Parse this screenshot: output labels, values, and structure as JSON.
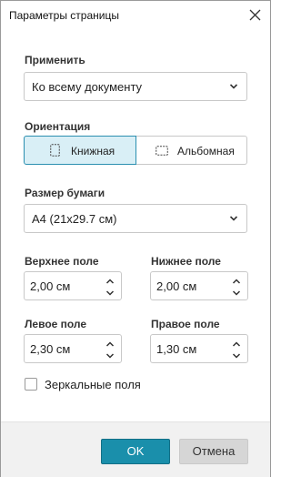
{
  "window": {
    "title": "Параметры страницы"
  },
  "apply": {
    "label": "Применить",
    "value": "Ко всему документу"
  },
  "orientation": {
    "label": "Ориентация",
    "portrait_label": "Книжная",
    "landscape_label": "Альбомная",
    "selected": "portrait"
  },
  "paper": {
    "label": "Размер бумаги",
    "value": "A4 (21x29.7 см)"
  },
  "margins": {
    "top": {
      "label": "Верхнее поле",
      "value": "2,00 см"
    },
    "bottom": {
      "label": "Нижнее поле",
      "value": "2,00 см"
    },
    "left": {
      "label": "Левое поле",
      "value": "2,30 см"
    },
    "right": {
      "label": "Правое поле",
      "value": "1,30 см"
    }
  },
  "mirror": {
    "label": "Зеркальные поля",
    "checked": false
  },
  "buttons": {
    "ok": "OK",
    "cancel": "Отмена"
  },
  "colors": {
    "accent": "#1a8fab",
    "selected_bg": "#d9eff6",
    "footer_bg": "#f1f1f1"
  },
  "icons": {
    "close": "close-icon",
    "dropdown": "chevron-down-icon",
    "spin_up": "chevron-up-icon",
    "spin_down": "chevron-down-icon",
    "portrait": "portrait-page-icon",
    "landscape": "landscape-page-icon"
  }
}
